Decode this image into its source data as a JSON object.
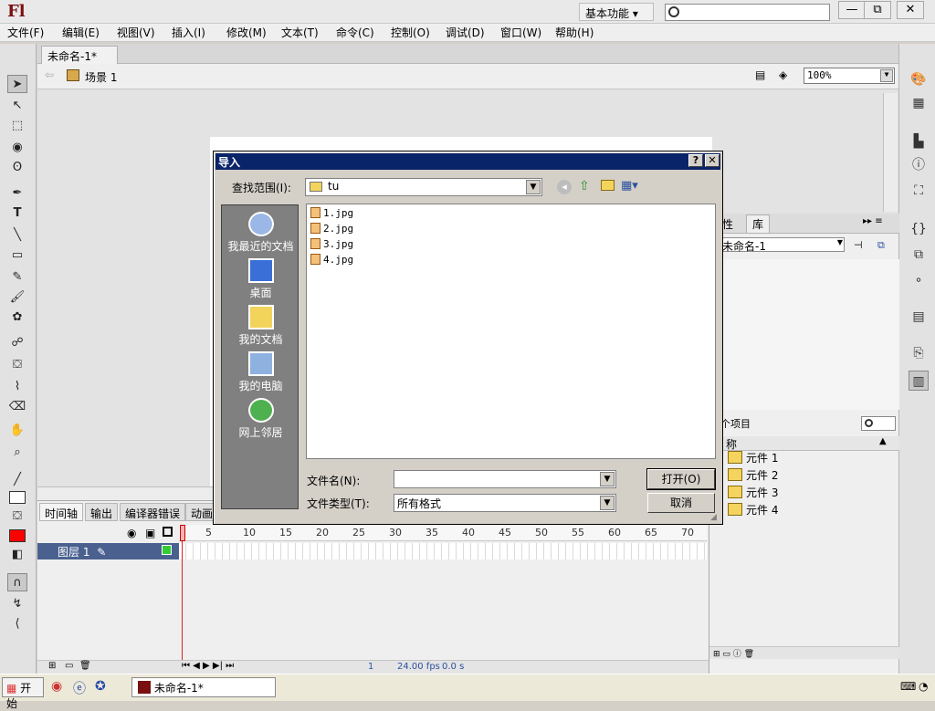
{
  "app": {
    "logo": "Fl",
    "workspace": "基本功能 ▾",
    "window_controls": [
      "—",
      "⧉",
      "✕"
    ]
  },
  "menu": [
    "文件(F)",
    "编辑(E)",
    "视图(V)",
    "插入(I)",
    "修改(M)",
    "文本(T)",
    "命令(C)",
    "控制(O)",
    "调试(D)",
    "窗口(W)",
    "帮助(H)"
  ],
  "document": {
    "tab": "未命名-1*",
    "close": "×",
    "scene": "场景 1",
    "zoom": "100%"
  },
  "timeline": {
    "tabs": [
      "时间轴",
      "输出",
      "编译器错误",
      "动画"
    ],
    "layer": "图层 1",
    "ruler": [
      "1",
      "5",
      "10",
      "15",
      "20",
      "25",
      "30",
      "35",
      "40",
      "45",
      "50",
      "55",
      "60",
      "65",
      "70"
    ],
    "frame": "1",
    "fps": "24.00 fps",
    "time": "0.0 s"
  },
  "library": {
    "tabs": [
      "性",
      "库"
    ],
    "doc": "未命名-1",
    "count": "个项目",
    "col_name": "称",
    "items": [
      "元件 1",
      "元件 2",
      "元件 3",
      "元件 4"
    ]
  },
  "taskbar": {
    "start": "开始",
    "window": "未命名-1*"
  },
  "dialog": {
    "title": "导入",
    "help": "?",
    "close": "✕",
    "lookin_label": "查找范围(I):",
    "lookin_value": "tu",
    "places": [
      "我最近的文档",
      "桌面",
      "我的文档",
      "我的电脑",
      "网上邻居"
    ],
    "files": [
      "1.jpg",
      "2.jpg",
      "3.jpg",
      "4.jpg"
    ],
    "filename_label": "文件名(N):",
    "filename_value": "",
    "filetype_label": "文件类型(T):",
    "filetype_value": "所有格式",
    "open": "打开(O)",
    "cancel": "取消"
  }
}
